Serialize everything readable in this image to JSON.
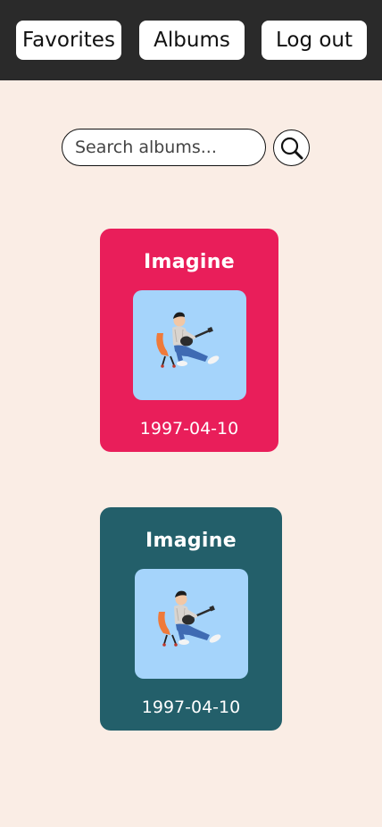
{
  "nav": {
    "favorites_label": "Favorites",
    "albums_label": "Albums",
    "logout_label": "Log out"
  },
  "search": {
    "placeholder": "Search albums...",
    "value": "",
    "button_icon": "search-icon"
  },
  "albums": [
    {
      "title": "Imagine",
      "date": "1997-04-10",
      "color": "#e91e5a",
      "art_icon": "album-cover-person-with-guitar"
    },
    {
      "title": "Imagine",
      "date": "1997-04-10",
      "color": "#235f6a",
      "art_icon": "album-cover-person-with-guitar"
    }
  ],
  "colors": {
    "topbar": "#2a2a2a",
    "background": "#faede5",
    "art_background": "#a5d4fb"
  }
}
